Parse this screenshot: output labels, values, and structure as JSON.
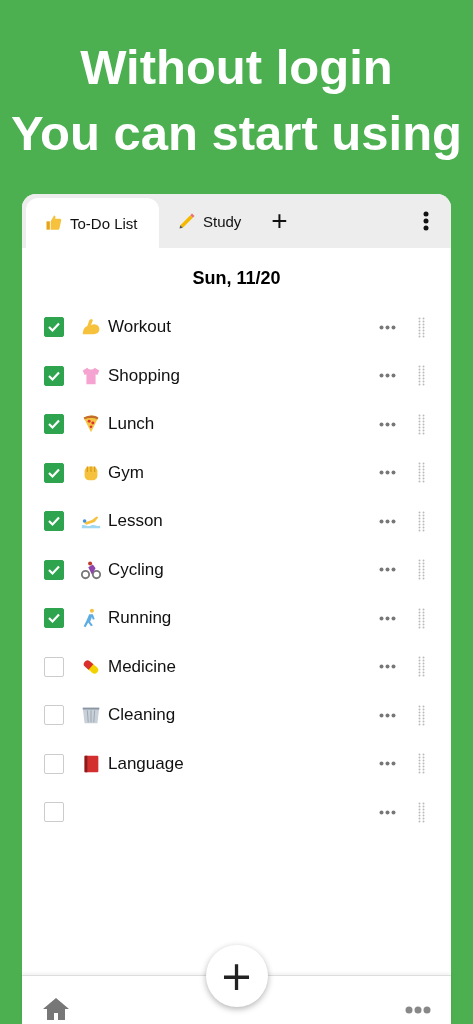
{
  "headline": [
    "Without login",
    "You can start using"
  ],
  "tabs": [
    {
      "label": "To-Do List",
      "kind": "thumb",
      "selected": true
    },
    {
      "label": "Study",
      "kind": "pencil",
      "selected": false
    }
  ],
  "add_tab": "+",
  "date": "Sun, 11/20",
  "tasks": [
    {
      "label": "Workout",
      "kind": "muscle",
      "checked": true
    },
    {
      "label": "Shopping",
      "kind": "shirt",
      "checked": true
    },
    {
      "label": "Lunch",
      "kind": "pizza",
      "checked": true
    },
    {
      "label": "Gym",
      "kind": "fist",
      "checked": true
    },
    {
      "label": "Lesson",
      "kind": "swimmer",
      "checked": true
    },
    {
      "label": "Cycling",
      "kind": "cyclist",
      "checked": true
    },
    {
      "label": "Running",
      "kind": "runner",
      "checked": true
    },
    {
      "label": "Medicine",
      "kind": "pill",
      "checked": false
    },
    {
      "label": "Cleaning",
      "kind": "wastebasket",
      "checked": false
    },
    {
      "label": "Language",
      "kind": "book",
      "checked": false
    },
    {
      "checked": false
    }
  ],
  "add_button": "+"
}
